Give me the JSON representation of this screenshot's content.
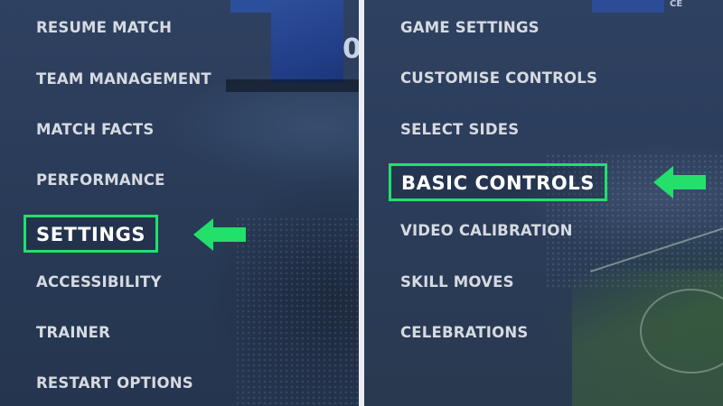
{
  "left_menu": {
    "items": [
      {
        "label": "RESUME MATCH"
      },
      {
        "label": "TEAM MANAGEMENT"
      },
      {
        "label": "MATCH FACTS"
      },
      {
        "label": "PERFORMANCE"
      },
      {
        "label": "SETTINGS",
        "selected": true
      },
      {
        "label": "ACCESSIBILITY"
      },
      {
        "label": "TRAINER"
      },
      {
        "label": "RESTART OPTIONS"
      }
    ]
  },
  "right_menu": {
    "items": [
      {
        "label": "GAME SETTINGS"
      },
      {
        "label": "CUSTOMISE CONTROLS"
      },
      {
        "label": "SELECT SIDES"
      },
      {
        "label": "BASIC CONTROLS",
        "selected": true
      },
      {
        "label": "VIDEO CALIBRATION"
      },
      {
        "label": "SKILL MOVES"
      },
      {
        "label": "CELEBRATIONS"
      }
    ]
  },
  "scoreboard": {
    "digit": "0"
  },
  "top_board": {
    "text": "CE"
  },
  "colors": {
    "highlight": "#22e06a",
    "menu_text": "#d6dae1",
    "selected_text": "#ffffff",
    "background": "#2a3c59",
    "divider": "#e9edf3"
  },
  "icons": {
    "pointer": "left-arrow-icon"
  }
}
